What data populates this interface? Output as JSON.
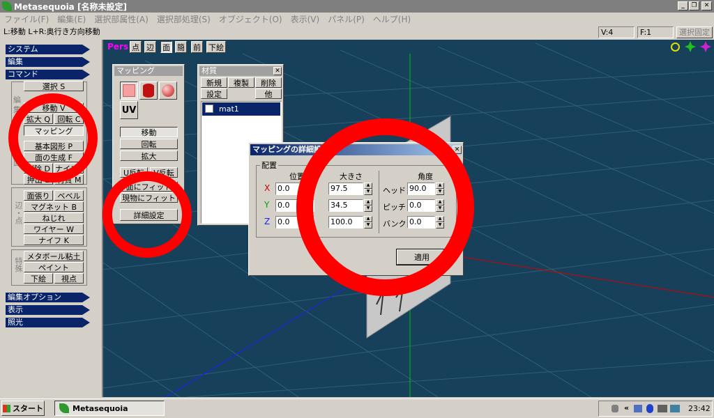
{
  "window": {
    "title": "Metasequoia [名称未設定]"
  },
  "menu": [
    "ファイル(F)",
    "編集(E)",
    "選択部属性(A)",
    "選択部処理(S)",
    "オブジェクト(O)",
    "表示(V)",
    "パネル(P)",
    "ヘルプ(H)"
  ],
  "status": {
    "hint": "L:移動  L+R:奥行き方向移動",
    "vertices": "V:4",
    "faces": "F:1",
    "select_lock": "選択固定"
  },
  "left_panel": {
    "system": "システム",
    "edit": "編集",
    "command": "コマンド",
    "commands": [
      "選択 S",
      "移動 V",
      "拡大 Q",
      "回転 C",
      "マッピング",
      "基本図形 P",
      "面の生成 F",
      "削除 D",
      "ナイフ I",
      "押出 E",
      "材質 M"
    ],
    "group_edges": "辺・点",
    "edge_cmds": [
      "面張り",
      "ベベル",
      "マグネット B",
      "ねじれ",
      "ワイヤー W",
      "ナイフ K"
    ],
    "group_special": "特殊",
    "special_cmds": [
      "メタボール粘土",
      "ペイント",
      "下絵",
      "視点"
    ],
    "edit_option": "編集オプション",
    "display": "表示",
    "lighting": "照光"
  },
  "viewport_toolbar": {
    "mode": "Pers",
    "buttons": [
      "点",
      "辺",
      "面",
      "簡",
      "前",
      "下絵"
    ]
  },
  "mapping_panel": {
    "title": "マッピング",
    "uv": "UV",
    "move": "移動",
    "rotate": "回転",
    "scale": "拡大",
    "flip_u": "U反転",
    "flip_v": "V反転",
    "fit_face": "面にフィット",
    "fit_object": "現物にフィット",
    "details": "詳細設定"
  },
  "material_panel": {
    "title": "材質",
    "new": "新規",
    "copy": "複製",
    "delete": "削除",
    "settings": "設定",
    "other": "他",
    "items": [
      "mat1"
    ]
  },
  "dialog": {
    "title": "マッピングの詳細設定",
    "group": "配置",
    "col_position": "位置",
    "col_size": "大きさ",
    "col_angle": "角度",
    "axes": [
      "X",
      "Y",
      "Z"
    ],
    "position": [
      "0.0",
      "0.0",
      "0.0"
    ],
    "size": [
      "97.5",
      "34.5",
      "100.0"
    ],
    "angle_labels": [
      "ヘッド",
      "ピッチ",
      "バンク"
    ],
    "angle": [
      "90.0",
      "0.0",
      "0.0"
    ],
    "apply": "適用"
  },
  "taskbar": {
    "start": "スタート",
    "app": "Metasequoia",
    "clock": "23:42"
  },
  "colors": {
    "annotation": "#ff0000",
    "viewport": "#17405a",
    "selection": "#0a246a"
  }
}
